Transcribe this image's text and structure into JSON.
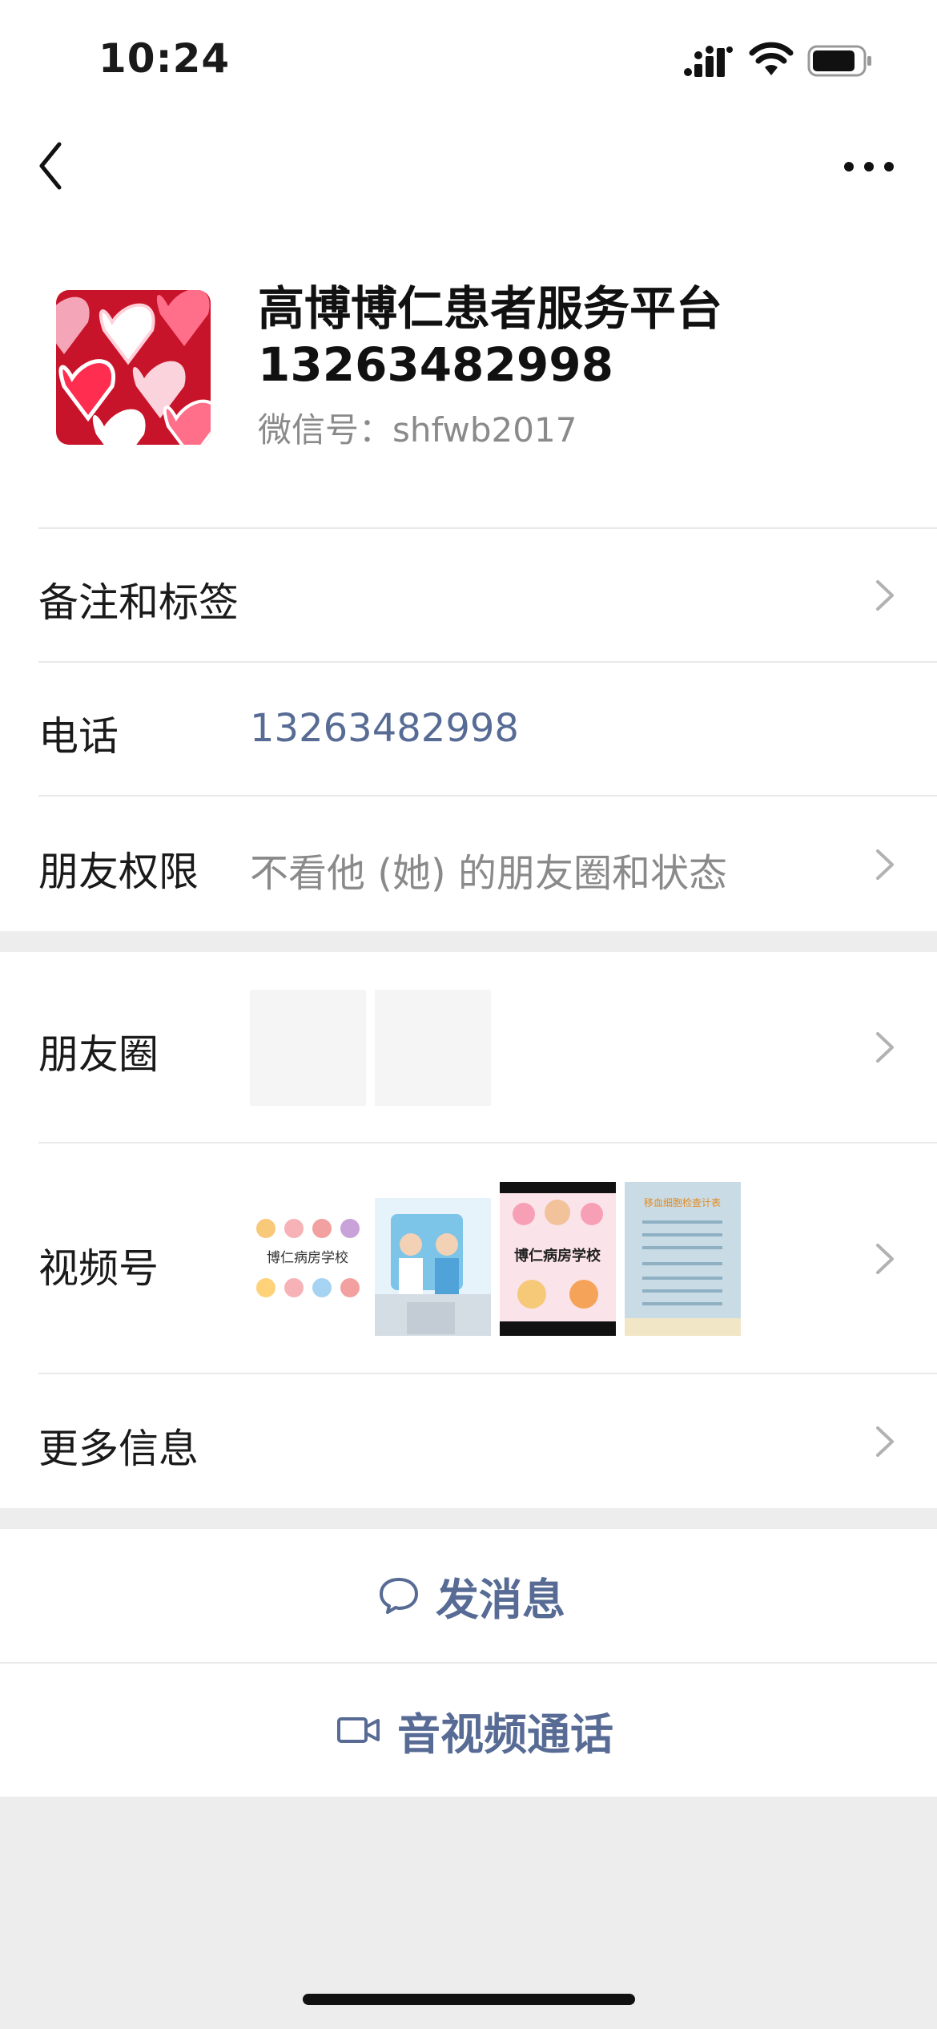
{
  "status_bar": {
    "time": "10:24"
  },
  "profile": {
    "name": "高博博仁患者服务平台13263482998",
    "wechat_id": "微信号：shfwb2017"
  },
  "rows": {
    "remark": {
      "label": "备注和标签"
    },
    "phone": {
      "label": "电话",
      "value": "13263482998"
    },
    "permission": {
      "label": "朋友权限",
      "value": "不看他 (她) 的朋友圈和状态"
    },
    "moments": {
      "label": "朋友圈"
    },
    "channels": {
      "label": "视频号",
      "thumbs": [
        {
          "text": "博仁病房学校"
        },
        {
          "text": ""
        },
        {
          "text": "博仁病房学校"
        },
        {
          "text": "移血细胞检查计表"
        }
      ]
    },
    "more": {
      "label": "更多信息"
    }
  },
  "actions": {
    "message": "发消息",
    "call": "音视频通话"
  },
  "colors": {
    "link": "#576b95",
    "background": "#ededed"
  }
}
